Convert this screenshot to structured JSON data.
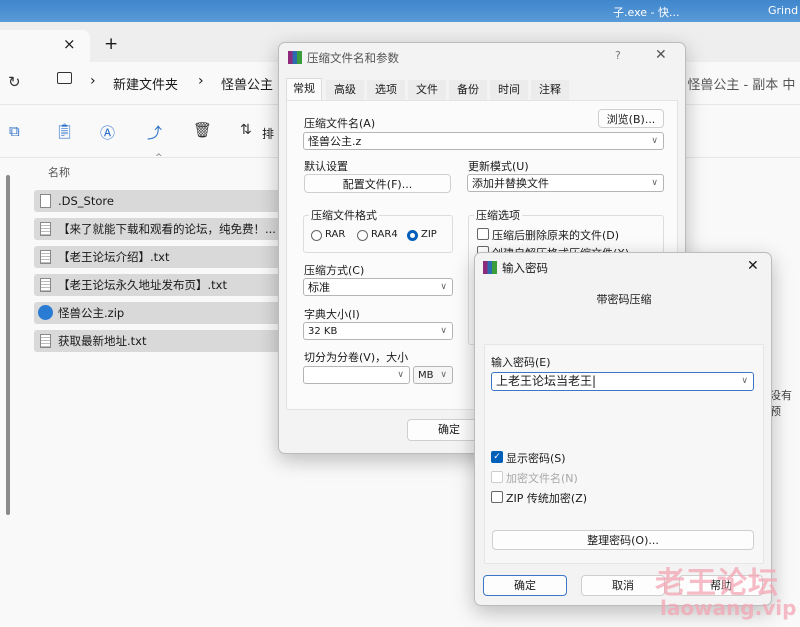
{
  "taskbar": {
    "items": [
      "子.exe - 快...",
      "Grind"
    ]
  },
  "explorer": {
    "tab_close": "×",
    "tab_add": "+",
    "breadcrumb": [
      "新建文件夹",
      "怪兽公主"
    ],
    "separator": "›",
    "search_hint": "E 怪兽公主 - 副本 中",
    "toolbar": {
      "sort_label": "排"
    },
    "column_name": "名称",
    "files": [
      {
        "name": ".DS_Store",
        "type": "blank"
      },
      {
        "name": "【来了就能下载和观看的论坛，纯免费！...",
        "type": "txt"
      },
      {
        "name": "【老王论坛介绍】.txt",
        "type": "txt"
      },
      {
        "name": "【老王论坛永久地址发布页】.txt",
        "type": "txt"
      },
      {
        "name": "怪兽公主.zip",
        "type": "zip"
      },
      {
        "name": "获取最新地址.txt",
        "type": "txt"
      }
    ],
    "preview_hint": "没有预"
  },
  "archive_dialog": {
    "title": "压缩文件名和参数",
    "help": "?",
    "close": "✕",
    "tabs": [
      "常规",
      "高级",
      "选项",
      "文件",
      "备份",
      "时间",
      "注释"
    ],
    "active_tab": "常规",
    "archive_name_label": "压缩文件名(A)",
    "browse": "浏览(B)...",
    "archive_name": "怪兽公主.z",
    "default_label": "默认设置",
    "profile_button": "配置文件(F)...",
    "update_label": "更新模式(U)",
    "update_value": "添加并替换文件",
    "format_label": "压缩文件格式",
    "formats": [
      "RAR",
      "RAR4",
      "ZIP"
    ],
    "selected_format": "ZIP",
    "options_label": "压缩选项",
    "option_delete": "压缩后删除原来的文件(D)",
    "option_sfx": "创建自解压格式压缩文件(X)",
    "method_label": "压缩方式(C)",
    "method_value": "标准",
    "dict_label": "字典大小(I)",
    "dict_value": "32 KB",
    "split_label": "切分为分卷(V)，大小",
    "split_value": "",
    "split_unit": "MB",
    "ok": "确定"
  },
  "password_dialog": {
    "title": "输入密码",
    "close": "✕",
    "heading": "带密码压缩",
    "password_label": "输入密码(E)",
    "password": "上老王论坛当老王",
    "show_password": "显示密码(S)",
    "show_password_checked": true,
    "encrypt_names": "加密文件名(N)",
    "encrypt_names_checked": false,
    "encrypt_names_disabled": true,
    "zip_legacy": "ZIP 传统加密(Z)",
    "zip_legacy_checked": false,
    "organize": "整理密码(O)...",
    "ok": "确定",
    "cancel": "取消",
    "help": "帮助"
  },
  "watermark": {
    "text": "老王论坛",
    "url": "laowang.vip",
    "color": "#f4a6b4"
  },
  "colors": {
    "accent": "#005fb8",
    "taskbar": "#4a8fd0"
  }
}
